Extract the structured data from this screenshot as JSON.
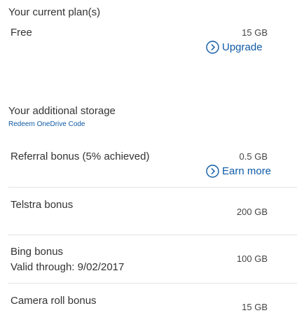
{
  "current_plan": {
    "heading": "Your current plan(s)",
    "plan_name": "Free",
    "plan_amount": "15 GB",
    "upgrade_label": "Upgrade"
  },
  "additional_storage": {
    "heading": "Your additional storage",
    "redeem_label": "Redeem OneDrive Code",
    "items": [
      {
        "label": "Referral bonus (5% achieved)",
        "amount": "0.5 GB",
        "action_label": "Earn more"
      },
      {
        "label": "Telstra bonus",
        "amount": "200 GB"
      },
      {
        "label": "Bing bonus",
        "sub_label": "Valid through: 9/02/2017",
        "amount": "100 GB"
      },
      {
        "label": "Camera roll bonus",
        "amount": "15 GB"
      }
    ]
  },
  "colors": {
    "link": "#0f5ba7",
    "text": "#333333",
    "divider": "#e3e3e3"
  },
  "icons": {
    "action": "chevron-right-circle-icon"
  }
}
